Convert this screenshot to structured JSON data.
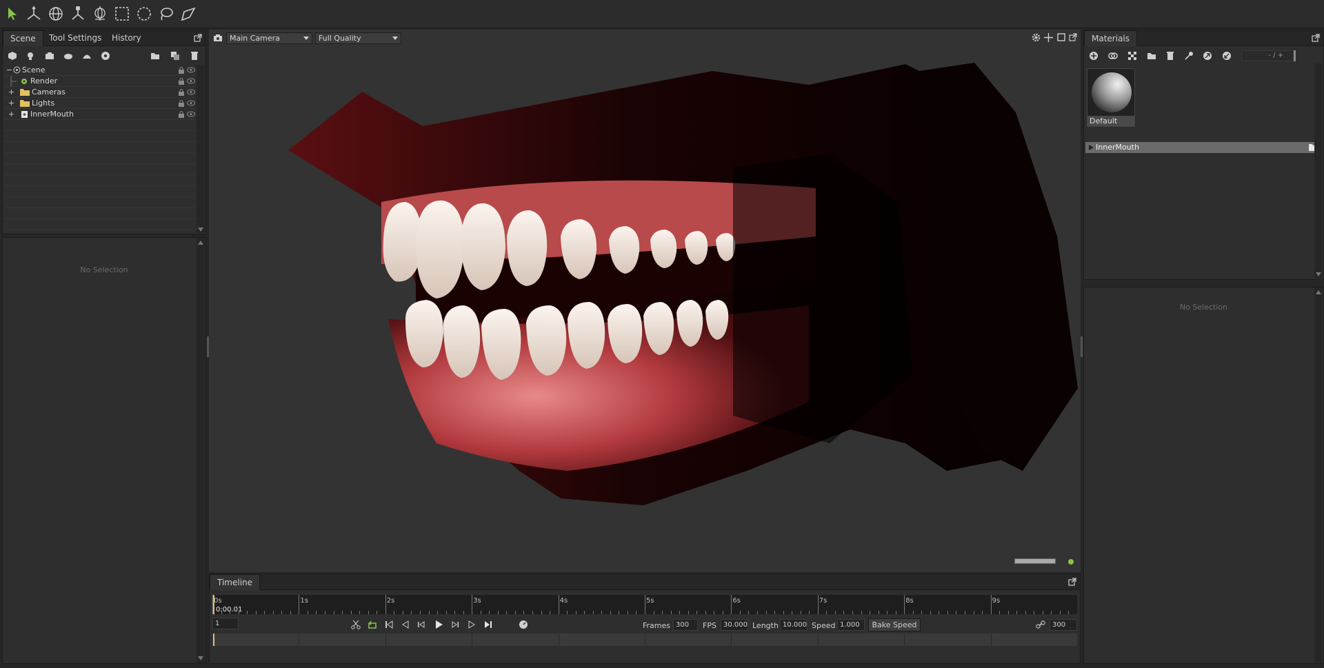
{
  "toolbar": {
    "tools": [
      "select-tool-icon",
      "move-tool-icon",
      "rotate-tool-icon",
      "scale-tool-icon",
      "transform-tool-icon",
      "box-select-icon",
      "circle-select-icon",
      "lasso-select-icon",
      "freehand-select-icon"
    ]
  },
  "left_panel": {
    "tabs": [
      "Scene",
      "Tool Settings",
      "History"
    ],
    "active_tab": "Scene",
    "tree": [
      {
        "label": "Scene",
        "type": "scene"
      },
      {
        "label": "Render",
        "type": "render"
      },
      {
        "label": "Cameras",
        "type": "folder"
      },
      {
        "label": "Lights",
        "type": "folder"
      },
      {
        "label": "InnerMouth",
        "type": "mesh"
      }
    ],
    "properties_empty": "No Selection"
  },
  "viewport": {
    "camera": "Main Camera",
    "quality": "Full Quality"
  },
  "timeline": {
    "tab": "Timeline",
    "seconds": [
      "0s",
      "1s",
      "2s",
      "3s",
      "4s",
      "5s",
      "6s",
      "7s",
      "8s",
      "9s"
    ],
    "current_time": "0:00.01",
    "current_frame": "1",
    "frames_label": "Frames",
    "frames": "300",
    "fps_label": "FPS",
    "fps": "30.000",
    "length_label": "Length",
    "length": "10.000",
    "speed_label": "Speed",
    "speed": "1.000",
    "bake_speed": "Bake Speed",
    "end_frame": "300"
  },
  "materials": {
    "tab": "Materials",
    "zoom_control": "- / +",
    "swatch_label": "Default",
    "groups": [
      "InnerMouth"
    ],
    "properties_empty": "No Selection"
  },
  "colors": {
    "accent_green": "#8bc34a",
    "folder_yellow": "#e0c060",
    "panel_bg": "#2e2e2e",
    "viewport_bg": "#333333"
  }
}
